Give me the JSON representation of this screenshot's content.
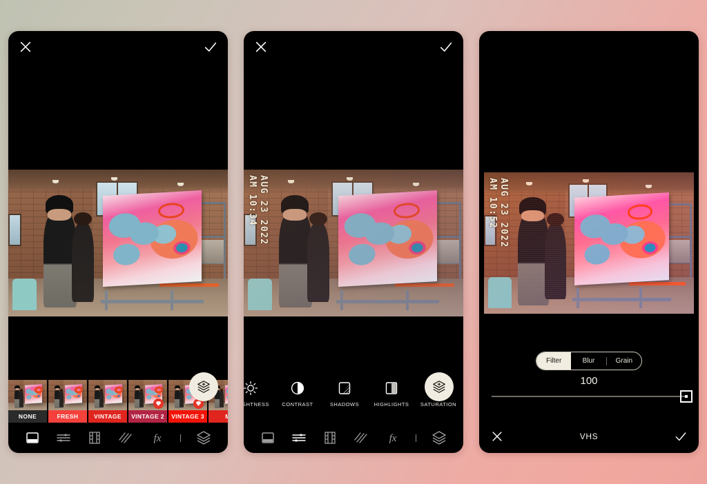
{
  "background": {
    "from": "#bfc2b2",
    "to": "#eda49c"
  },
  "panels": [
    {
      "id": "filters-panel",
      "topbar": {
        "close_icon": "close-icon",
        "confirm_icon": "check-icon"
      },
      "photo": {
        "timestamp_time": "",
        "timestamp_date": "",
        "alt": "two people viewing a large pink painting in a brick studio"
      },
      "fab": {
        "icon": "add-layer-icon"
      },
      "filters": [
        {
          "name": "NONE",
          "color": "#2b2b2b",
          "premium": false
        },
        {
          "name": "FRESH",
          "color": "#f4413c",
          "premium": false
        },
        {
          "name": "VINTAGE",
          "color": "#e0251f",
          "premium": false
        },
        {
          "name": "VINTAGE 2",
          "color": "#b32444",
          "premium": true
        },
        {
          "name": "VINTAGE 3",
          "color": "#f21409",
          "premium": true
        },
        {
          "name": "M",
          "color": "#e0251f",
          "premium": false
        }
      ],
      "toolbar": [
        {
          "icon": "filter-icon",
          "active": true
        },
        {
          "icon": "adjust-icon",
          "active": false
        },
        {
          "icon": "film-icon",
          "active": false
        },
        {
          "icon": "grain-icon",
          "active": false
        },
        {
          "icon": "fx-icon",
          "active": false
        },
        {
          "icon": "layers-icon",
          "active": false
        }
      ]
    },
    {
      "id": "adjustments-panel",
      "topbar": {
        "close_icon": "close-icon",
        "confirm_icon": "check-icon"
      },
      "photo": {
        "timestamp_time": "AM 10:34",
        "timestamp_date": "AUG 23 2022",
        "alt": "two people viewing a large pink painting in a brick studio"
      },
      "fab": {
        "icon": "add-layer-icon"
      },
      "adjustments": [
        {
          "label": "BRIGHTNESS",
          "icon": "brightness-icon"
        },
        {
          "label": "CONTRAST",
          "icon": "contrast-icon"
        },
        {
          "label": "SHADOWS",
          "icon": "shadows-icon"
        },
        {
          "label": "HIGHLIGHTS",
          "icon": "highlights-icon"
        },
        {
          "label": "SATURATION",
          "icon": "saturation-icon"
        }
      ],
      "toolbar": [
        {
          "icon": "filter-icon",
          "active": false
        },
        {
          "icon": "adjust-icon",
          "active": true
        },
        {
          "icon": "film-icon",
          "active": false
        },
        {
          "icon": "grain-icon",
          "active": false
        },
        {
          "icon": "fx-icon",
          "active": false
        },
        {
          "icon": "layers-icon",
          "active": false
        }
      ]
    },
    {
      "id": "vhs-filter-panel",
      "topbar": {
        "close_icon": "close-icon",
        "confirm_icon": "check-icon"
      },
      "photo": {
        "timestamp_time": "AM 10:52",
        "timestamp_date": "AUG 23 2022",
        "alt": "two people viewing a large pink painting in a brick studio, VHS filter applied"
      },
      "segments": [
        {
          "label": "Filter",
          "active": true
        },
        {
          "label": "Blur",
          "active": false
        },
        {
          "label": "Grain",
          "active": false
        }
      ],
      "slider": {
        "value": "100",
        "percent": 100,
        "min": 0,
        "max": 100
      },
      "footer": {
        "cancel_icon": "close-icon",
        "filter_name": "VHS",
        "confirm_icon": "check-icon"
      }
    }
  ]
}
